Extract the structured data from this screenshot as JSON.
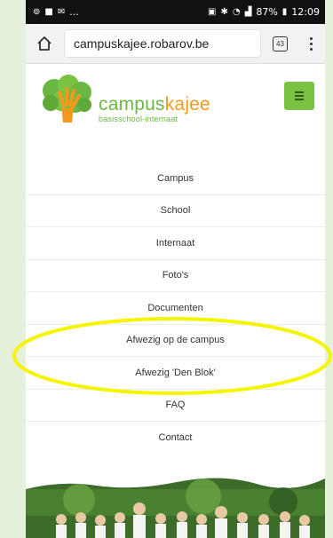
{
  "statusbar": {
    "battery": "87%",
    "time": "12:09",
    "left_ellipsis": "..."
  },
  "browser": {
    "url": "campuskajee.robarov.be",
    "tab_count": "43"
  },
  "site": {
    "brand_part1": "campus",
    "brand_part2": "kajee",
    "tagline": "basisschool-internaat"
  },
  "nav": {
    "items": [
      {
        "label": "Campus"
      },
      {
        "label": "School"
      },
      {
        "label": "Internaat"
      },
      {
        "label": "Foto's"
      },
      {
        "label": "Documenten"
      },
      {
        "label": "Afwezig op de campus"
      },
      {
        "label": "Afwezig 'Den Blok'"
      },
      {
        "label": "FAQ"
      },
      {
        "label": "Contact"
      }
    ]
  },
  "colors": {
    "brand_green": "#6bb744",
    "brand_orange": "#f39a1e",
    "hamburger_green": "#7cc242",
    "highlight_yellow": "#f5f500",
    "page_background": "#e6f1dc"
  },
  "icons": {
    "home": "home-icon",
    "tabs": "tabs-icon",
    "menu": "more-vert-icon",
    "hamburger": "hamburger-icon",
    "logo": "tree-hand-logo"
  }
}
